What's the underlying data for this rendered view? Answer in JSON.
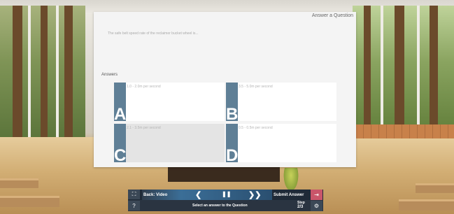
{
  "panel": {
    "title": "Answer a Question",
    "question": "The safe belt speed rate of the reclaimer bucket wheel is...",
    "answers_label": "Answers",
    "options": [
      {
        "letter": "A",
        "text": "1.0 - 2.0m per second",
        "selected": false
      },
      {
        "letter": "B",
        "text": "3.5 - 5.0m per second",
        "selected": false
      },
      {
        "letter": "C",
        "text": "2.1 - 3.5m per second",
        "selected": true
      },
      {
        "letter": "D",
        "text": "0.5 - 0.5m per second",
        "selected": false
      }
    ]
  },
  "controls": {
    "back_label": "Back: Video",
    "submit_label": "Submit Answer",
    "status_text": "Select an answer to the Question",
    "step_label": "Step",
    "step_value": "2/3",
    "icons": {
      "fullscreen": "fullscreen-icon",
      "help": "help-icon",
      "prev": "chevron-left-icon",
      "pause": "pause-icon",
      "next": "double-chevron-right-icon",
      "exit": "exit-icon",
      "settings": "gear-icon"
    },
    "colors": {
      "bar": "#2a3441",
      "accent": "#3b6e97",
      "exit": "#c9556a",
      "answer_bar": "#5f7f96"
    }
  }
}
